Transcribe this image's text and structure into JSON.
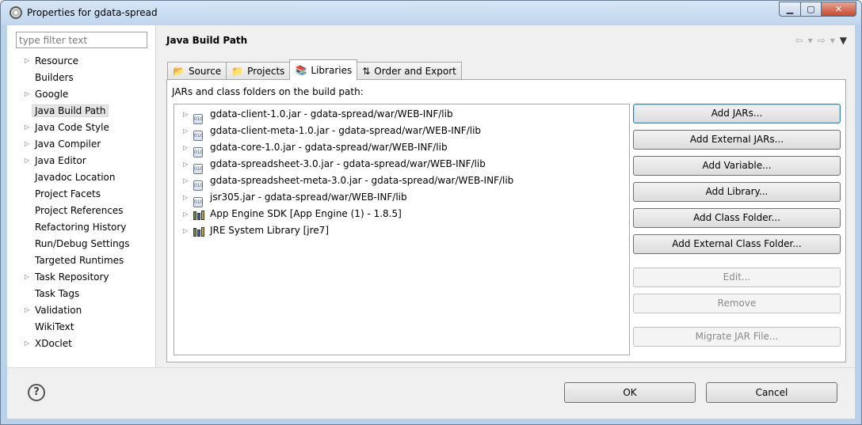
{
  "window": {
    "title": "Properties for gdata-spread"
  },
  "filter": {
    "placeholder": "type filter text"
  },
  "nav": {
    "items": [
      {
        "label": "Resource",
        "expandable": true
      },
      {
        "label": "Builders",
        "expandable": false
      },
      {
        "label": "Google",
        "expandable": true
      },
      {
        "label": "Java Build Path",
        "expandable": false,
        "selected": true
      },
      {
        "label": "Java Code Style",
        "expandable": true
      },
      {
        "label": "Java Compiler",
        "expandable": true
      },
      {
        "label": "Java Editor",
        "expandable": true
      },
      {
        "label": "Javadoc Location",
        "expandable": false
      },
      {
        "label": "Project Facets",
        "expandable": false
      },
      {
        "label": "Project References",
        "expandable": false
      },
      {
        "label": "Refactoring History",
        "expandable": false
      },
      {
        "label": "Run/Debug Settings",
        "expandable": false
      },
      {
        "label": "Targeted Runtimes",
        "expandable": false
      },
      {
        "label": "Task Repository",
        "expandable": true
      },
      {
        "label": "Task Tags",
        "expandable": false
      },
      {
        "label": "Validation",
        "expandable": true
      },
      {
        "label": "WikiText",
        "expandable": false
      },
      {
        "label": "XDoclet",
        "expandable": true
      }
    ]
  },
  "page": {
    "title": "Java Build Path"
  },
  "tabs": [
    {
      "label": "Source",
      "icon": "source-folder-icon"
    },
    {
      "label": "Projects",
      "icon": "projects-icon"
    },
    {
      "label": "Libraries",
      "icon": "libraries-icon",
      "active": true
    },
    {
      "label": "Order and Export",
      "icon": "order-export-icon"
    }
  ],
  "libraries": {
    "label": "JARs and class folders on the build path:",
    "entries": [
      {
        "label": "gdata-client-1.0.jar - gdata-spread/war/WEB-INF/lib",
        "icon": "jar-icon"
      },
      {
        "label": "gdata-client-meta-1.0.jar - gdata-spread/war/WEB-INF/lib",
        "icon": "jar-icon"
      },
      {
        "label": "gdata-core-1.0.jar - gdata-spread/war/WEB-INF/lib",
        "icon": "jar-icon"
      },
      {
        "label": "gdata-spreadsheet-3.0.jar - gdata-spread/war/WEB-INF/lib",
        "icon": "jar-icon"
      },
      {
        "label": "gdata-spreadsheet-meta-3.0.jar - gdata-spread/war/WEB-INF/lib",
        "icon": "jar-icon"
      },
      {
        "label": "jsr305.jar - gdata-spread/war/WEB-INF/lib",
        "icon": "jar-icon"
      },
      {
        "label": "App Engine SDK [App Engine (1) - 1.8.5]",
        "icon": "library-icon"
      },
      {
        "label": "JRE System Library [jre7]",
        "icon": "library-icon"
      }
    ]
  },
  "buttons": {
    "add_jars": "Add JARs...",
    "add_external_jars": "Add External JARs...",
    "add_variable": "Add Variable...",
    "add_library": "Add Library...",
    "add_class_folder": "Add Class Folder...",
    "add_external_class_folder": "Add External Class Folder...",
    "edit": "Edit...",
    "remove": "Remove",
    "migrate_jar": "Migrate JAR File..."
  },
  "dialog": {
    "ok": "OK",
    "cancel": "Cancel"
  }
}
